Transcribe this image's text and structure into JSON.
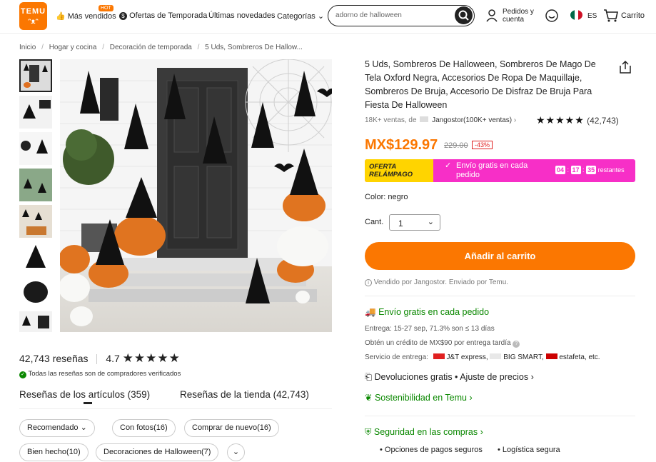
{
  "header": {
    "logo_line1": "TEMU",
    "logo_line2": "ᵔᴥᵔ",
    "hot_badge": "HOT",
    "nav_best_sellers": "Más vendidos",
    "nav_season_deals": "Ofertas de Temporada",
    "nav_new": "Últimas novedades",
    "nav_categories": "Categorías",
    "search_value": "adorno de halloween",
    "orders_line1": "Pedidos y",
    "orders_line2": "cuenta",
    "lang": "ES",
    "cart_label": "Carrito"
  },
  "breadcrumb": [
    "Inicio",
    "Hogar y cocina",
    "Decoración de temporada",
    "5 Uds, Sombreros De Hallow..."
  ],
  "product": {
    "title": "5 Uds, Sombreros De Halloween, Sombreros De Mago De Tela Oxford Negra, Accesorios De Ropa De Maquillaje, Sombreros De Bruja, Accesorio De Disfraz De Bruja Para Fiesta De Halloween",
    "sales": "18K+ ventas, de",
    "seller": "Jangostor(100K+ ventas)",
    "rating_count": "(42,743)",
    "price": "MX$129.97",
    "old_price": "229.00",
    "discount": "-43%",
    "flash_line1": "OFERTA",
    "flash_line2": "RELÁMPAGO",
    "flash_shipping": "Envío gratis en cada pedido",
    "timer_h": "04",
    "timer_m": "17",
    "timer_s": "35",
    "timer_suffix": "restantes",
    "color_label": "Color: negro",
    "qty_label": "Cant.",
    "qty_value": "1",
    "add_to_cart": "Añadir al carrito",
    "sold_by": "Vendido por Jangostor. Enviado por Temu."
  },
  "shipping": {
    "free_title": "Envío gratis en cada pedido",
    "delivery": "Entrega: 15-27 sep, 71.3% son ≤ 13 días",
    "credit": "Obtén un crédito de MX$90 por entrega tardía",
    "service_label": "Servicio de entrega:",
    "carrier1": "J&T express,",
    "carrier2": "BIG SMART,",
    "carrier3": "estafeta, etc.",
    "returns": "Devoluciones gratis • Ajuste de precios",
    "sustain": "Sostenibilidad en Temu",
    "security": "Seguridad en las compras",
    "sec_item1": "Opciones de pagos seguros",
    "sec_item2": "Logística segura"
  },
  "reviews": {
    "count_label": "42,743 reseñas",
    "rating": "4.7",
    "verified": "Todas las reseñas son de compradores verificados",
    "tab_items": "Reseñas de los artículos (359)",
    "tab_store": "Reseñas de la tienda (42,743)",
    "filters": [
      "Recomendado",
      "Con fotos(16)",
      "Comprar de nuevo(16)",
      "Bien hecho(10)",
      "Decoraciones de Halloween(7)"
    ]
  },
  "colors": {
    "accent": "#fb7701",
    "flash": "#f72fc7",
    "green": "#0a8800"
  },
  "rating_stars": 4.7
}
